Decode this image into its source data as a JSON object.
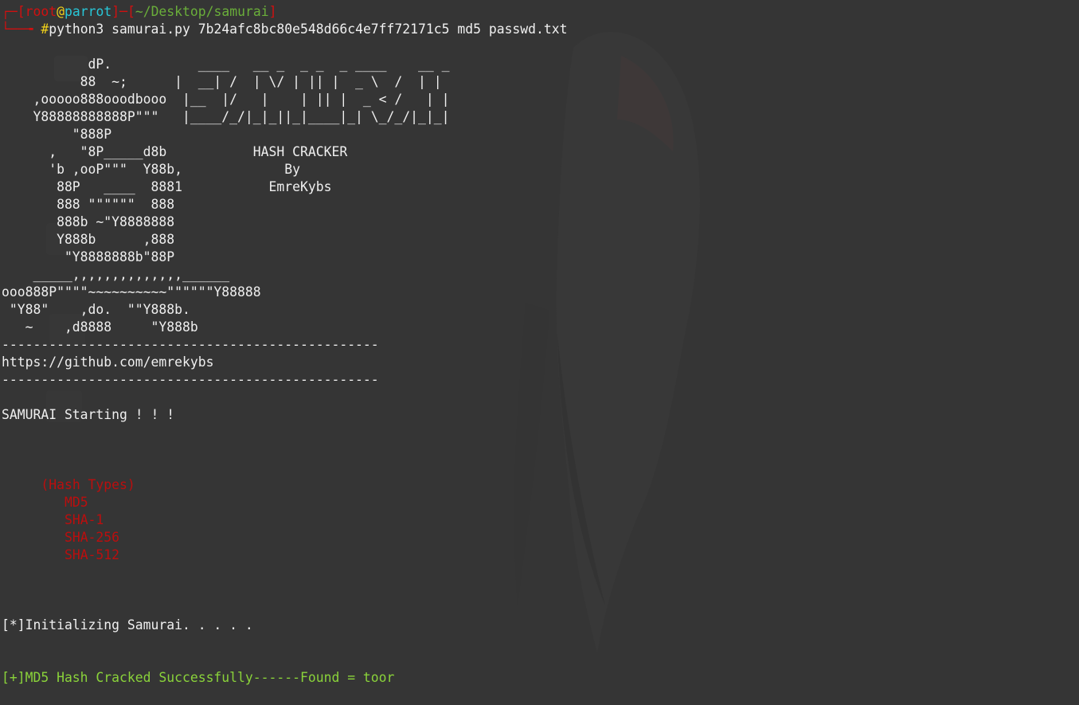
{
  "prompt": {
    "corner": "┌─",
    "bracket_open": "[",
    "user": "root",
    "at": "@",
    "host": "parrot",
    "bracket_close": "]",
    "separator": "─[",
    "path": "~/Desktop/samurai",
    "path_close": "]",
    "arrow": "└──╼ ",
    "hash_symbol": "#",
    "command": "python3 samurai.py 7b24afc8bc80e548d66c4e7ff72171c5 md5 passwd.txt"
  },
  "banner_lines": [
    "",
    "           dP.           ____   __ _  _ _  _ ____    __ _",
    "          88  ~;      |  __| /  | \\/ | || |  _ \\  /  | |",
    "    ,ooooo888ooodbooo  |__  |/   |    | || |  _ < /   | |",
    "    Y88888888888P\"\"\"   |____/_/|_|_||_|____|_| \\_/_/|_|_|",
    "         \"888P",
    "      ,   \"8P_____d8b           HASH CRACKER",
    "      'b ,ooP\"\"\"  Y88b,             By",
    "       88P   ____  8881           EmreKybs",
    "       888 \"\"\"\"\"\"  888",
    "       888b ~\"Y8888888",
    "       Y888b      ,888",
    "        \"Y8888888b\"88P",
    "    _____,,,,,,,,,,,,,,______",
    "ooo888P\"\"\"\"~~~~~~~~~~\"\"\"\"\"\"Y88888",
    " \"Y88\"    ,do.  \"\"Y888b.",
    "   ~    ,d8888     \"Y888b"
  ],
  "separator_line": "------------------------------------------------",
  "github_url": "https://github.com/emrekybs",
  "starting_text": "SAMURAI Starting ! ! !",
  "hash_types_title": "(Hash Types)",
  "hash_types": [
    "MD5",
    "SHA-1",
    "SHA-256",
    "SHA-512"
  ],
  "init_text": "[*]Initializing Samurai. . . . .",
  "result_text": "[+]MD5 Hash Cracked Successfully------Found = toor",
  "colors": {
    "background": "#353535",
    "prompt_red": "#d01010",
    "host_cyan": "#28c7d8",
    "hash_yellow": "#f2d21a",
    "success_green": "#8ad33a",
    "hash_types_red": "#bb0e0e"
  },
  "wallpaper_icon": "parrot-wallpaper-icon"
}
